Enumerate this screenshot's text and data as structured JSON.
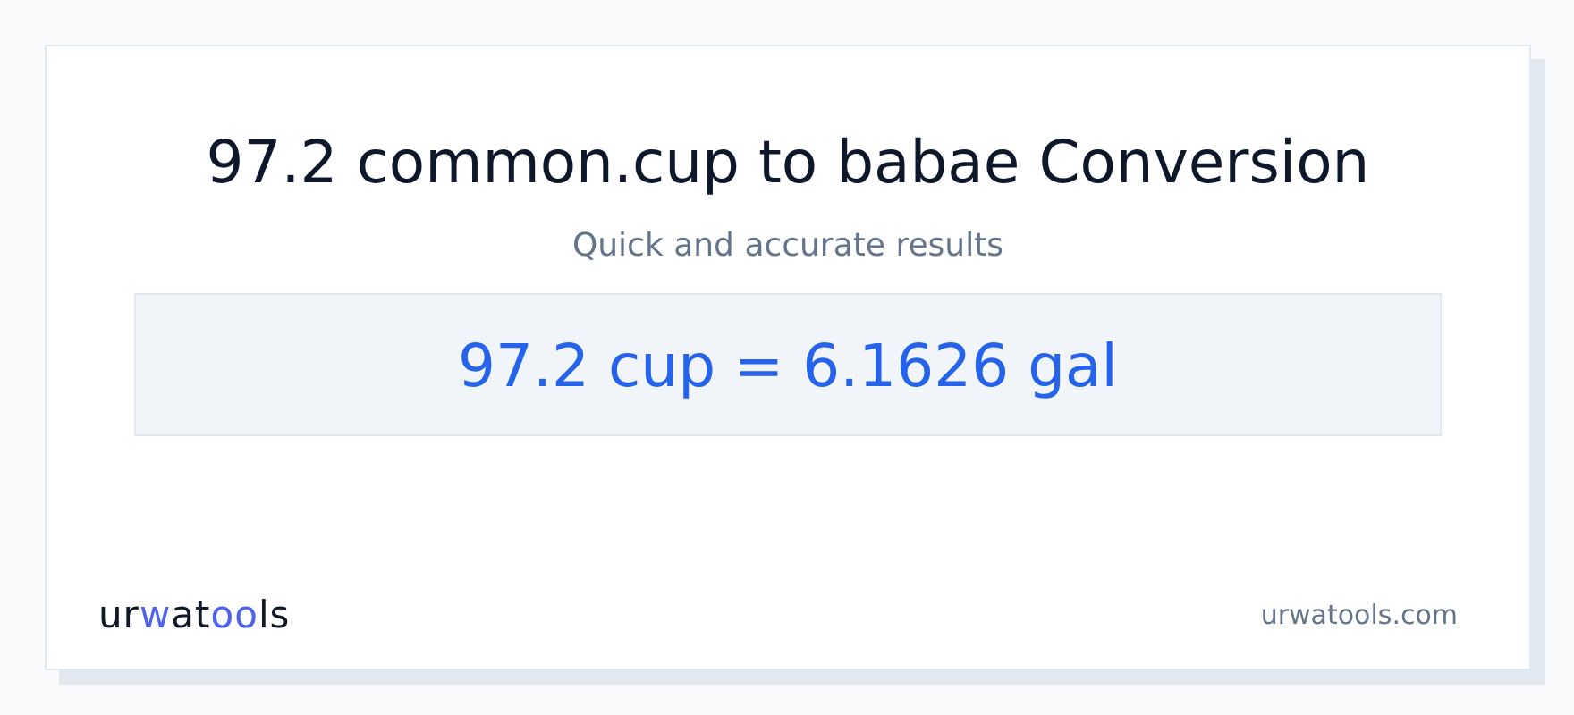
{
  "title": "97.2 common.cup to babae Conversion",
  "subtitle": "Quick and accurate results",
  "result": "97.2 cup = 6.1626 gal",
  "logo": [
    {
      "text": "ur",
      "accent": false
    },
    {
      "text": "w",
      "accent": true
    },
    {
      "text": "at",
      "accent": false
    },
    {
      "text": "oo",
      "accent": true
    },
    {
      "text": "ls",
      "accent": false
    }
  ],
  "site": "urwatools.com"
}
